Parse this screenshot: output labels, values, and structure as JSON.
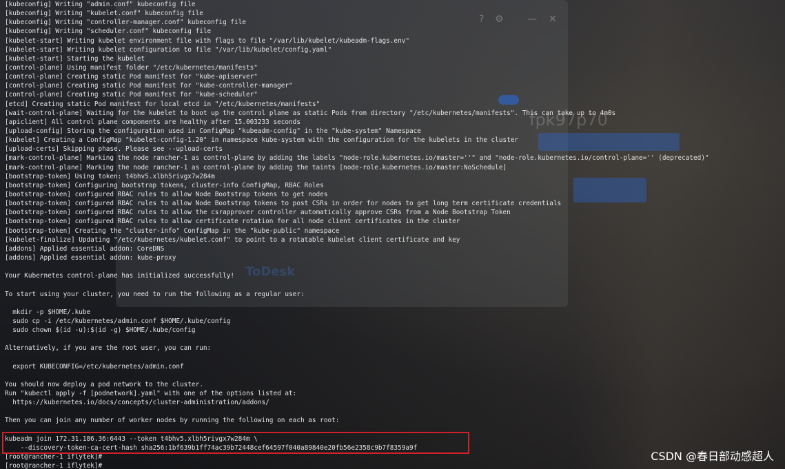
{
  "terminal": {
    "lines": [
      "[kubeconfig] Writing \"admin.conf\" kubeconfig file",
      "[kubeconfig] Writing \"kubelet.conf\" kubeconfig file",
      "[kubeconfig] Writing \"controller-manager.conf\" kubeconfig file",
      "[kubeconfig] Writing \"scheduler.conf\" kubeconfig file",
      "[kubelet-start] Writing kubelet environment file with flags to file \"/var/lib/kubelet/kubeadm-flags.env\"",
      "[kubelet-start] Writing kubelet configuration to file \"/var/lib/kubelet/config.yaml\"",
      "[kubelet-start] Starting the kubelet",
      "[control-plane] Using manifest folder \"/etc/kubernetes/manifests\"",
      "[control-plane] Creating static Pod manifest for \"kube-apiserver\"",
      "[control-plane] Creating static Pod manifest for \"kube-controller-manager\"",
      "[control-plane] Creating static Pod manifest for \"kube-scheduler\"",
      "[etcd] Creating static Pod manifest for local etcd in \"/etc/kubernetes/manifests\"",
      "[wait-control-plane] Waiting for the kubelet to boot up the control plane as static Pods from directory \"/etc/kubernetes/manifests\". This can take up to 4m0s",
      "[apiclient] All control plane components are healthy after 15.003233 seconds",
      "[upload-config] Storing the configuration used in ConfigMap \"kubeadm-config\" in the \"kube-system\" Namespace",
      "[kubelet] Creating a ConfigMap \"kubelet-config-1.20\" in namespace kube-system with the configuration for the kubelets in the cluster",
      "[upload-certs] Skipping phase. Please see --upload-certs",
      "[mark-control-plane] Marking the node rancher-1 as control-plane by adding the labels \"node-role.kubernetes.io/master=''\" and \"node-role.kubernetes.io/control-plane='' (deprecated)\"",
      "[mark-control-plane] Marking the node rancher-1 as control-plane by adding the taints [node-role.kubernetes.io/master:NoSchedule]",
      "[bootstrap-token] Using token: t4bhv5.xlbh5rivgx7w284m",
      "[bootstrap-token] Configuring bootstrap tokens, cluster-info ConfigMap, RBAC Roles",
      "[bootstrap-token] configured RBAC rules to allow Node Bootstrap tokens to get nodes",
      "[bootstrap-token] configured RBAC rules to allow Node Bootstrap tokens to post CSRs in order for nodes to get long term certificate credentials",
      "[bootstrap-token] configured RBAC rules to allow the csrapprover controller automatically approve CSRs from a Node Bootstrap Token",
      "[bootstrap-token] configured RBAC rules to allow certificate rotation for all node client certificates in the cluster",
      "[bootstrap-token] Creating the \"cluster-info\" ConfigMap in the \"kube-public\" namespace",
      "[kubelet-finalize] Updating \"/etc/kubernetes/kubelet.conf\" to point to a rotatable kubelet client certificate and key",
      "[addons] Applied essential addon: CoreDNS",
      "[addons] Applied essential addon: kube-proxy",
      "",
      "Your Kubernetes control-plane has initialized successfully!",
      "",
      "To start using your cluster, you need to run the following as a regular user:",
      "",
      "  mkdir -p $HOME/.kube",
      "  sudo cp -i /etc/kubernetes/admin.conf $HOME/.kube/config",
      "  sudo chown $(id -u):$(id -g) $HOME/.kube/config",
      "",
      "Alternatively, if you are the root user, you can run:",
      "",
      "  export KUBECONFIG=/etc/kubernetes/admin.conf",
      "",
      "You should now deploy a pod network to the cluster.",
      "Run \"kubectl apply -f [podnetwork].yaml\" with one of the options listed at:",
      "  https://kubernetes.io/docs/concepts/cluster-administration/addons/",
      "",
      "Then you can join any number of worker nodes by running the following on each as root:",
      "",
      "kubeadm join 172.31.186.36:6443 --token t4bhv5.xlbh5rivgx7w284m \\",
      "    --discovery-token-ca-cert-hash sha256:1bf639b1ff74ac39b72448cef64597f040a89840e20fb56e2358c9b7f8359a9f",
      "[root@rancher-1 iflytek]#",
      "[root@rancher-1 iflytek]#"
    ]
  },
  "overlay": {
    "code_text": "fpk97p70",
    "brand_text": "ToDesk"
  },
  "watermark": "CSDN @春日部动感超人",
  "colors": {
    "terminal_text": "#e3e3e3",
    "highlight_border": "#d2202a",
    "accent_blue": "#2b6fe6"
  }
}
